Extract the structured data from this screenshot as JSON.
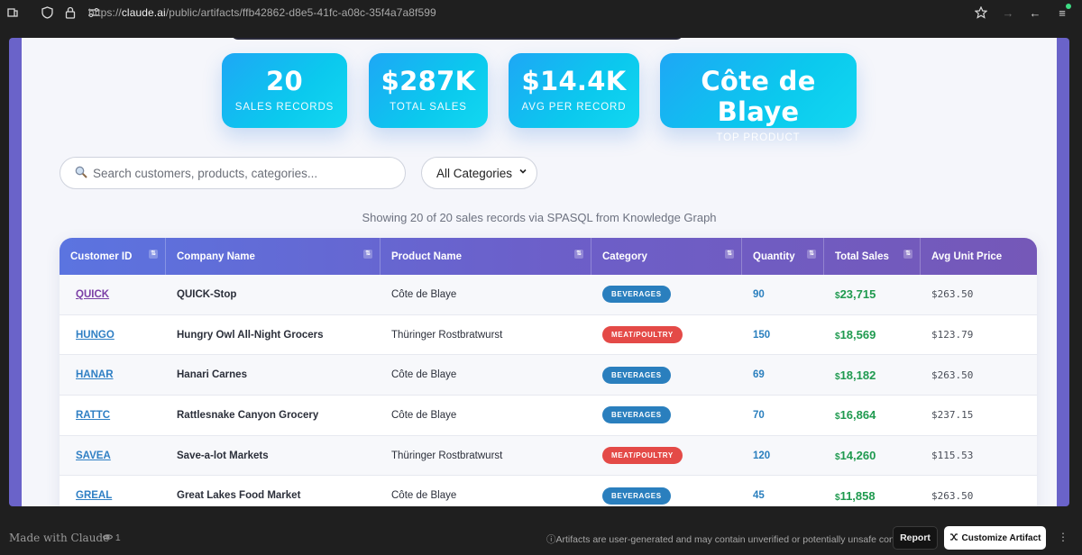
{
  "browser": {
    "url_prefix": "https://",
    "url_host": "claude.ai",
    "url_path": "/public/artifacts/ffb42862-d8e5-41fc-a08c-35f4a7a8f599"
  },
  "stats": [
    {
      "value": "20",
      "label": "SALES RECORDS"
    },
    {
      "value": "$287K",
      "label": "TOTAL SALES"
    },
    {
      "value": "$14.4K",
      "label": "AVG PER RECORD"
    },
    {
      "value": "Côte de Blaye",
      "label": "TOP PRODUCT"
    }
  ],
  "search": {
    "placeholder": "Search customers, products, categories..."
  },
  "category_filter": {
    "selected": "All Categories"
  },
  "showing_text": "Showing 20 of 20 sales records via SPASQL from Knowledge Graph",
  "table": {
    "headers": [
      "Customer ID",
      "Company Name",
      "Product Name",
      "Category",
      "Quantity",
      "Total Sales",
      "Avg Unit Price"
    ],
    "rows": [
      {
        "id": "QUICK",
        "company": "QUICK-Stop",
        "product": "Côte de Blaye",
        "category": "BEVERAGES",
        "qty": "90",
        "total": "23,715",
        "avg": "$263.50"
      },
      {
        "id": "HUNGO",
        "company": "Hungry Owl All-Night Grocers",
        "product": "Thüringer Rostbratwurst",
        "category": "MEAT/POULTRY",
        "qty": "150",
        "total": "18,569",
        "avg": "$123.79"
      },
      {
        "id": "HANAR",
        "company": "Hanari Carnes",
        "product": "Côte de Blaye",
        "category": "BEVERAGES",
        "qty": "69",
        "total": "18,182",
        "avg": "$263.50"
      },
      {
        "id": "RATTC",
        "company": "Rattlesnake Canyon Grocery",
        "product": "Côte de Blaye",
        "category": "BEVERAGES",
        "qty": "70",
        "total": "16,864",
        "avg": "$237.15"
      },
      {
        "id": "SAVEA",
        "company": "Save-a-lot Markets",
        "product": "Thüringer Rostbratwurst",
        "category": "MEAT/POULTRY",
        "qty": "120",
        "total": "14,260",
        "avg": "$115.53"
      },
      {
        "id": "GREAL",
        "company": "Great Lakes Food Market",
        "product": "Côte de Blaye",
        "category": "BEVERAGES",
        "qty": "45",
        "total": "11,858",
        "avg": "$263.50"
      }
    ]
  },
  "footer": {
    "made_with": "Made with Claude",
    "views": "1",
    "disclaimer": "Artifacts are user-generated and may contain unverified or potentially unsafe content.",
    "report": "Report",
    "customize": "Customize Artifact"
  },
  "colors": {
    "stat_gradient_start": "#1ea7f5",
    "stat_gradient_end": "#12d8f0",
    "header_gradient_start": "#5b74e0",
    "header_gradient_end": "#7558b8",
    "beverages_badge": "#2a7fbe",
    "meat_badge": "#e44a47",
    "total_green": "#1f9a4f"
  }
}
